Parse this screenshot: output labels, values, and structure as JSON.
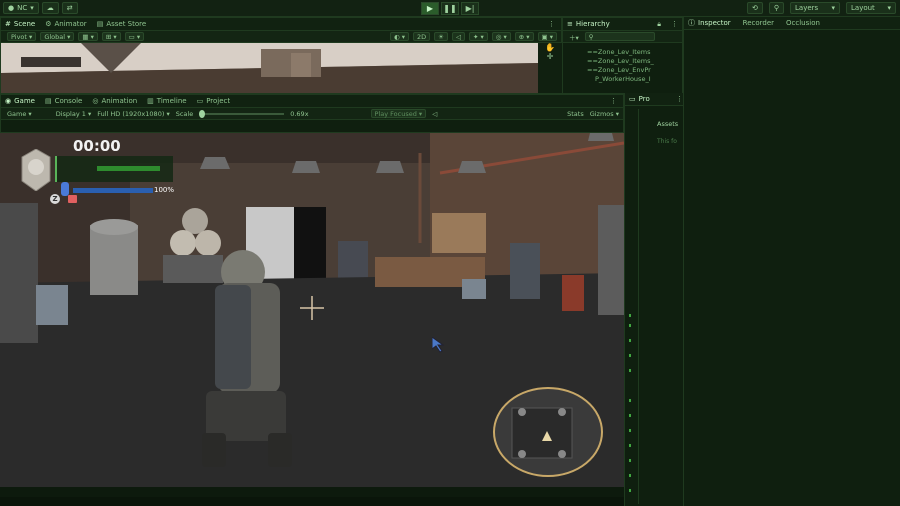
{
  "toolbar": {
    "account": "NC",
    "layers": "Layers",
    "layout": "Layout"
  },
  "scene_panel": {
    "tabs": [
      "Scene",
      "Animator",
      "Asset Store"
    ],
    "controls": {
      "pivot": "Pivot",
      "global": "Global",
      "mode_2d": "2D"
    }
  },
  "hierarchy": {
    "title": "Hierarchy",
    "rows": [
      "==Zone_Lev_Items",
      "==Zone_Lev_Items_",
      "==Zone_Lev_EnvPr",
      "P_WorkerHouse_I"
    ]
  },
  "inspector_tabs": [
    "Inspector",
    "Recorder",
    "Occlusion"
  ],
  "game_panel": {
    "tabs": [
      "Game",
      "Console",
      "Animation",
      "Timeline",
      "Project"
    ],
    "subbar": {
      "mode": "Game",
      "display": "Display 1",
      "resolution": "Full HD (1920x1080)",
      "scale_label": "Scale",
      "scale_value": "0.69x",
      "play_focused": "Play Focused",
      "stats": "Stats",
      "gizmos": "Gizmos"
    }
  },
  "project_strip": {
    "tab": "Pro",
    "assets_label": "Assets",
    "hint": "This fo"
  },
  "hud": {
    "timer": "00:00",
    "energy_percent_label": "100%",
    "health_fraction": 0.9,
    "energy_fraction": 1.0,
    "z_key": "Z"
  },
  "colors": {
    "accent": "#2b5c2b",
    "panel_text": "#9fd39f",
    "health": "#2e8b2e",
    "energy": "#2a5fb0"
  }
}
